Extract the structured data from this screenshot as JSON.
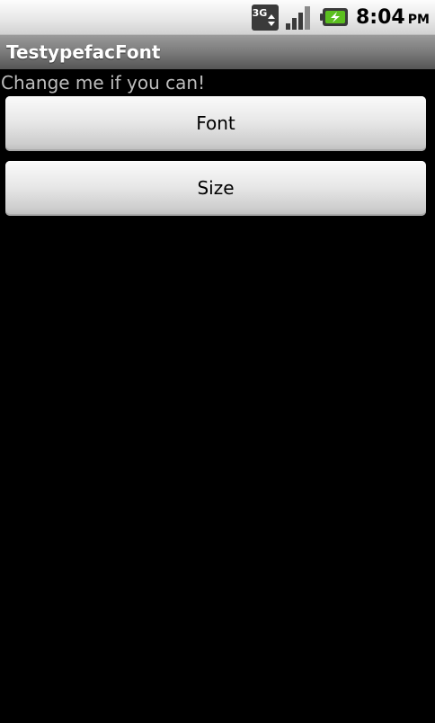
{
  "status_bar": {
    "network_label": "3G",
    "time": "8:04",
    "ampm": "PM",
    "icons": [
      "3g-data-icon",
      "signal-strength-icon",
      "battery-charging-icon"
    ]
  },
  "app": {
    "title": "TestypefacFont"
  },
  "content": {
    "label": "Change me if you can!",
    "font_button_label": "Font",
    "size_button_label": "Size"
  },
  "colors": {
    "background": "#000000",
    "label_text": "#bdbdbd",
    "title_text": "#ffffff",
    "battery_accent": "#5bbf1f"
  }
}
